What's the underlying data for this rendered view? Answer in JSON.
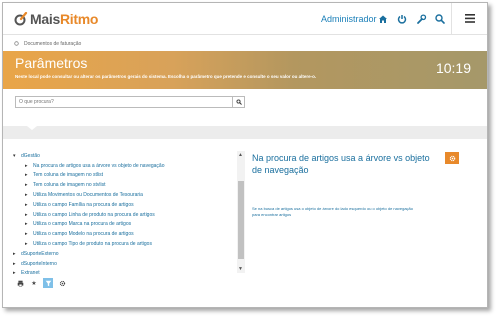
{
  "app": {
    "logo_prefix": "Mais",
    "logo_suffix": "Ritmo",
    "user": "Administrador",
    "nav_icons": [
      "home-icon",
      "power-icon",
      "wrench-icon",
      "search-icon"
    ],
    "menu_icon": "hamburger-icon"
  },
  "breadcrumb": {
    "label": "Documentos de faturação"
  },
  "banner": {
    "title": "Parâmetros",
    "subtitle": "Neste local pode consultar ou alterar os parâmetros gerais do sistema. Escolha o parâmetro que pretende e consulte o seu valor ou altere-o.",
    "time": "10:19"
  },
  "search": {
    "placeholder": "O que procura?"
  },
  "tree": {
    "groups": [
      {
        "label": "dGestão",
        "expanded": true
      },
      {
        "label": "dSuporteExterno",
        "expanded": false
      },
      {
        "label": "dSuporteInterno",
        "expanded": false
      },
      {
        "label": "Extranet",
        "expanded": false
      }
    ],
    "children": [
      "Na procura de artigos usa a árvore vs objeto de navegação",
      "Tem coluna de imagem no stlist",
      "Tem coluna de imagem no stvlist",
      "Utiliza Movimentos ou Documentos de Tesouraria",
      "Utiliza o campo Família na procura de artigos",
      "Utiliza o campo Linha de produto na procura de artigos",
      "Utiliza o campo Marca na procura de artigos",
      "Utiliza o campo Modelo na procura de artigos",
      "Utiliza o campo Tipo de produto na procura de artigos"
    ]
  },
  "detail": {
    "title": "Na procura de artigos usa a árvore vs objeto de navegação",
    "description": "Se na busca de artigos usa o objeto de árvore do lado esquerdo ou o objeto de navegação para encontrar artigos",
    "button_icon": "gear-icon"
  },
  "colors": {
    "accent": "#e8892a",
    "link": "#1a6f9e"
  }
}
